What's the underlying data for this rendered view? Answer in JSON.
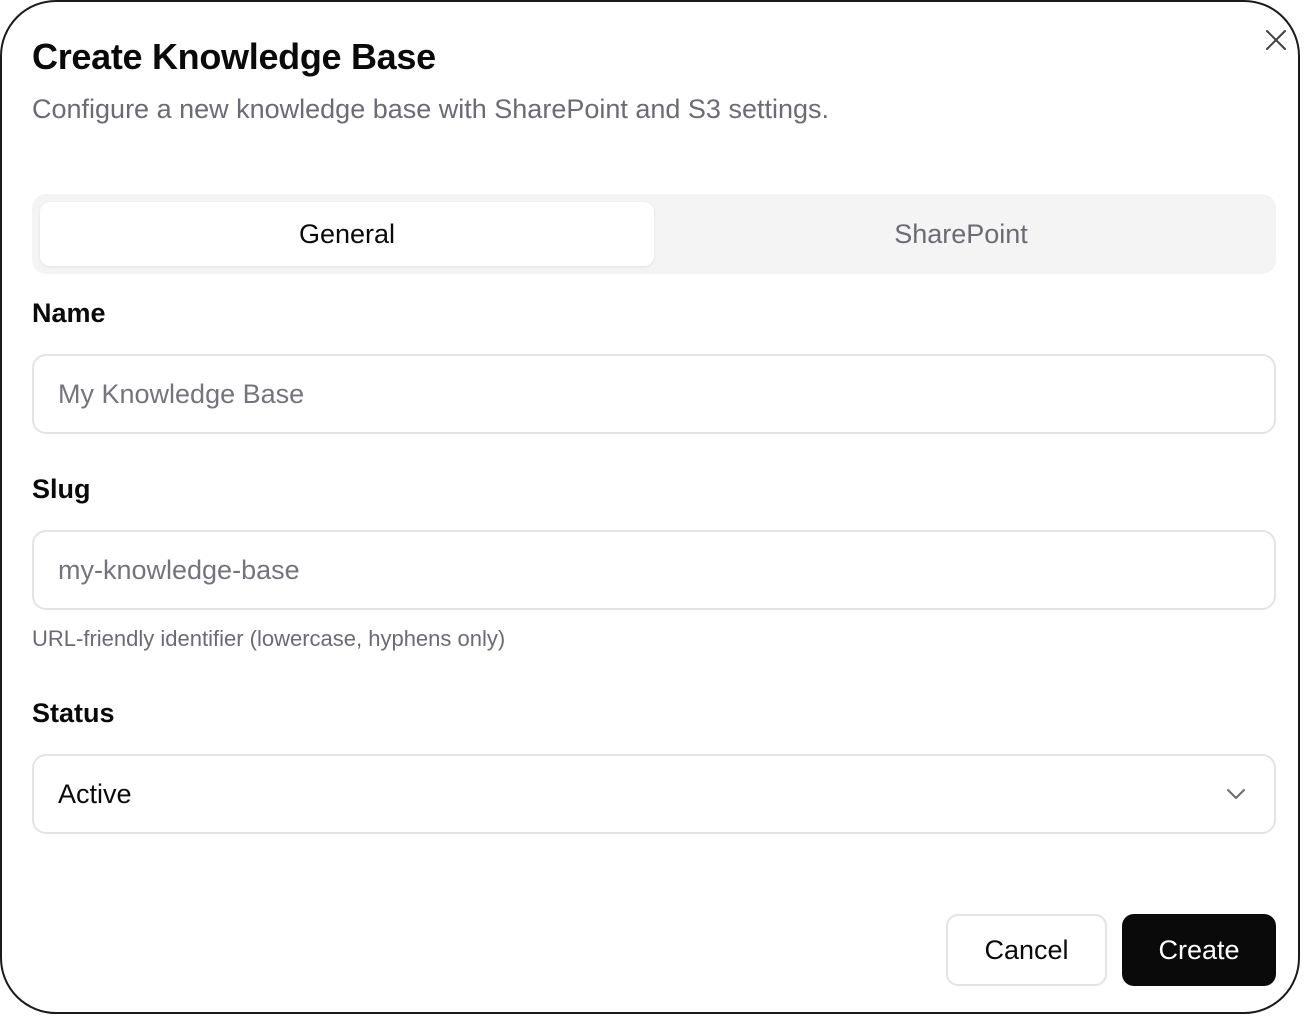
{
  "dialog": {
    "title": "Create Knowledge Base",
    "description": "Configure a new knowledge base with SharePoint and S3 settings.",
    "close_icon": "close-icon"
  },
  "tabs": [
    {
      "label": "General",
      "active": true
    },
    {
      "label": "SharePoint",
      "active": false
    }
  ],
  "form": {
    "name": {
      "label": "Name",
      "value": "",
      "placeholder": "My Knowledge Base"
    },
    "slug": {
      "label": "Slug",
      "value": "",
      "placeholder": "my-knowledge-base",
      "hint": "URL-friendly identifier (lowercase, hyphens only)"
    },
    "status": {
      "label": "Status",
      "selected": "Active",
      "icon": "chevron-down-icon"
    }
  },
  "footer": {
    "cancel_label": "Cancel",
    "create_label": "Create"
  },
  "colors": {
    "primary": "#0a0a0a",
    "muted_text": "#6b6b73",
    "border": "#e4e4e7",
    "tab_track": "#f4f4f5"
  }
}
